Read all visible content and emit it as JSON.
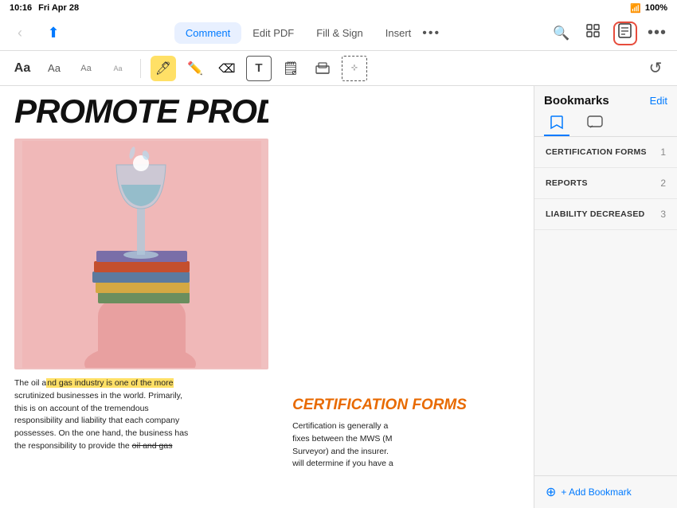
{
  "statusBar": {
    "time": "10:16",
    "day": "Fri Apr 28",
    "wifi": "📶",
    "battery": "100%"
  },
  "topToolbar": {
    "backLabel": "‹",
    "shareLabel": "⬆",
    "moreDots": "•••",
    "tabs": [
      {
        "id": "comment",
        "label": "Comment",
        "active": true
      },
      {
        "id": "editpdf",
        "label": "Edit PDF",
        "active": false
      },
      {
        "id": "fillsign",
        "label": "Fill & Sign",
        "active": false
      },
      {
        "id": "insert",
        "label": "Insert",
        "active": false
      }
    ],
    "searchIcon": "🔍",
    "gridIcon": "⊞",
    "bookmarkIcon": "🔖",
    "moreIcon": "•••"
  },
  "annotationToolbar": {
    "buttons": [
      {
        "id": "text-large",
        "label": "Aa",
        "size": "large"
      },
      {
        "id": "text-medium",
        "label": "Aa",
        "size": "medium"
      },
      {
        "id": "text-small1",
        "label": "Aa",
        "size": "small"
      },
      {
        "id": "text-small2",
        "label": "Aa",
        "size": "xsmall"
      },
      {
        "id": "highlight",
        "label": "🖊",
        "style": "highlight"
      },
      {
        "id": "pen",
        "label": "✏",
        "style": "pen"
      },
      {
        "id": "eraser",
        "label": "⌫",
        "style": "eraser"
      },
      {
        "id": "textbox",
        "label": "T",
        "style": "textbox"
      },
      {
        "id": "sticky",
        "label": "🗒",
        "style": "sticky"
      },
      {
        "id": "stamp",
        "label": "☰",
        "style": "stamp"
      }
    ],
    "undoLabel": "↺"
  },
  "pdfContent": {
    "title": "PROMOTE PRODUCTI",
    "bodyText": "The oil and gas industry is one of the more scrutinized businesses in the world. Primarily, this is on account of the tremendous responsibility and liability that each company possesses. On the one hand, the business has the responsibility to provide the oil and gas",
    "highlightText": "nd gas industry is one of the more",
    "certHeading": "CERTIFICATION FORMS",
    "certText": "Certification is generally a fixes between the MWS (M Surveyor) and the insurer. will determine if you have a"
  },
  "sidebar": {
    "title": "Bookmarks",
    "editLabel": "Edit",
    "tabs": [
      {
        "id": "bookmark",
        "icon": "🔖",
        "active": true
      },
      {
        "id": "comment",
        "icon": "💬",
        "active": false
      }
    ],
    "bookmarks": [
      {
        "id": 1,
        "name": "CERTIFICATION FORMS",
        "num": "1"
      },
      {
        "id": 2,
        "name": "REPORTS",
        "num": "2"
      },
      {
        "id": 3,
        "name": "LIABILITY DECREASED",
        "num": "3"
      }
    ],
    "addBookmarkLabel": "+ Add Bookmark"
  }
}
